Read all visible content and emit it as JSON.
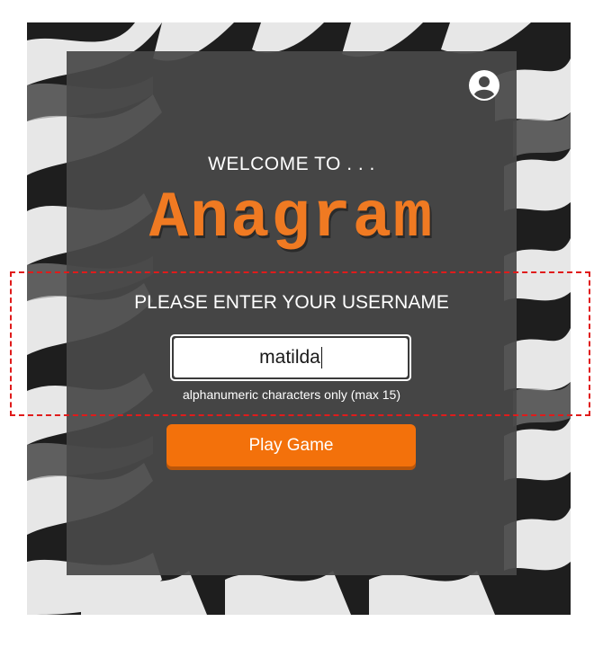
{
  "header": {
    "account_icon": "account-circle-icon"
  },
  "welcome": {
    "text": "WELCOME TO . . .",
    "logo": "Anagram"
  },
  "username_form": {
    "prompt": "PLEASE ENTER YOUR USERNAME",
    "input_value": "matilda",
    "hint": "alphanumeric characters only (max 15)"
  },
  "actions": {
    "play_label": "Play Game"
  },
  "colors": {
    "accent": "#f3710b",
    "logo": "#f07a22",
    "card_background": "#484848",
    "highlight": "#e01b1b"
  }
}
